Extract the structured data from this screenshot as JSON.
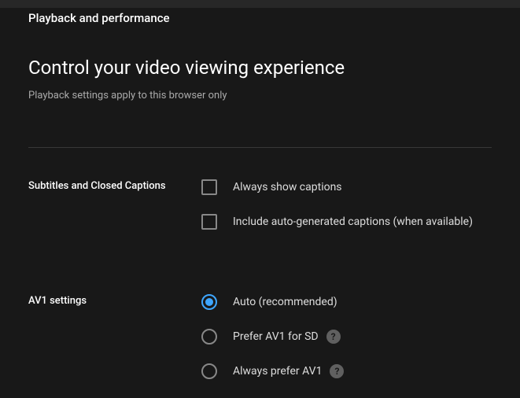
{
  "breadcrumb": "Playback and performance",
  "title": "Control your video viewing experience",
  "subtitle": "Playback settings apply to this browser only",
  "sections": {
    "captions": {
      "label": "Subtitles and Closed Captions",
      "options": {
        "always_show": "Always show captions",
        "auto_generated": "Include auto-generated captions (when available)"
      }
    },
    "av1": {
      "label": "AV1 settings",
      "options": {
        "auto": "Auto (recommended)",
        "prefer_sd": "Prefer AV1 for SD",
        "always": "Always prefer AV1"
      }
    }
  },
  "help_glyph": "?"
}
